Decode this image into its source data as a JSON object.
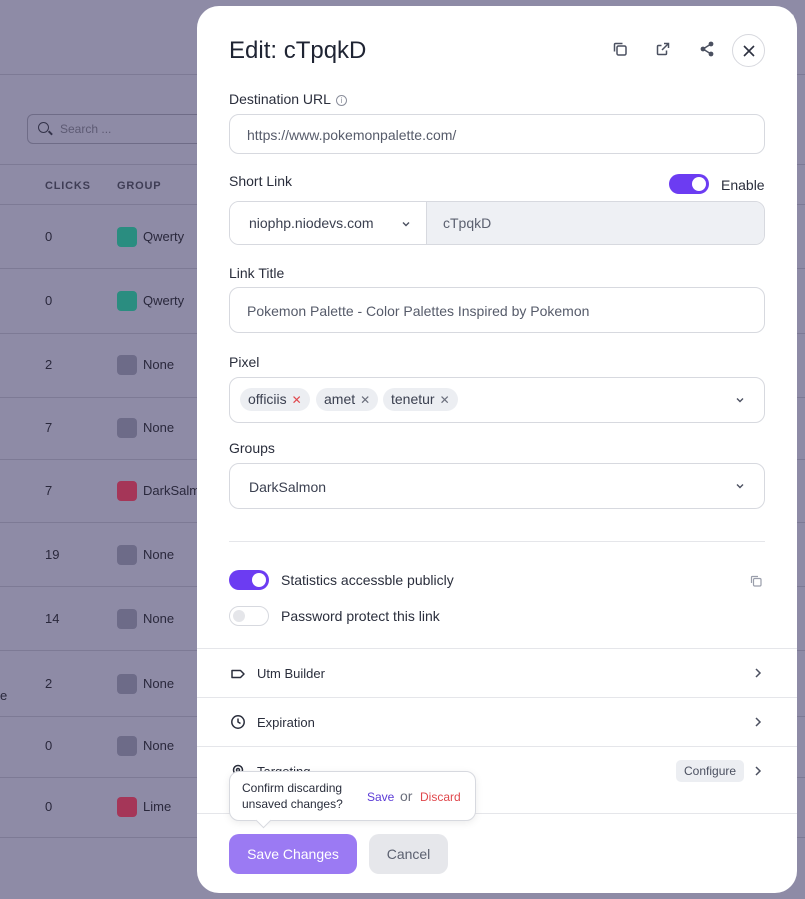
{
  "background": {
    "search_placeholder": "Search ...",
    "col_clicks": "CLICKS",
    "col_group": "GROUP",
    "rows": [
      {
        "clicks": "0",
        "group": "Qwerty",
        "color": "#2a8d80"
      },
      {
        "clicks": "0",
        "group": "Qwerty",
        "color": "#2a8d80"
      },
      {
        "clicks": "2",
        "group": "None",
        "color": "#6d6b88"
      },
      {
        "clicks": "7",
        "group": "None",
        "color": "#6d6b88"
      },
      {
        "clicks": "7",
        "group": "DarkSalm",
        "color": "#a53658"
      },
      {
        "clicks": "19",
        "group": "None",
        "color": "#6d6b88"
      },
      {
        "clicks": "14",
        "group": "None",
        "color": "#6d6b88"
      },
      {
        "clicks": "2",
        "group": "None",
        "color": "#6d6b88"
      },
      {
        "clicks": "0",
        "group": "None",
        "color": "#6d6b88"
      },
      {
        "clicks": "0",
        "group": "Lime",
        "color": "#a53658"
      }
    ],
    "edge_text": "e"
  },
  "modal": {
    "title": "Edit: cTpqkD",
    "header_icons": [
      "copy-icon",
      "external-link-icon",
      "share-icon",
      "close-icon"
    ],
    "destination": {
      "label": "Destination URL",
      "value": "https://www.pokemonpalette.com/"
    },
    "short_link": {
      "label": "Short Link",
      "enable_label": "Enable",
      "enabled": true,
      "domain": "niophp.niodevs.com",
      "slug": "cTpqkD"
    },
    "link_title": {
      "label": "Link Title",
      "value": "Pokemon Palette - Color Palettes Inspired by Pokemon"
    },
    "pixel": {
      "label": "Pixel",
      "chips": [
        "officiis",
        "amet",
        "tenetur"
      ]
    },
    "groups": {
      "label": "Groups",
      "value": "DarkSalmon"
    },
    "statistics": {
      "label": "Statistics accessble publicly",
      "enabled": true
    },
    "password": {
      "label": "Password protect this link",
      "enabled": false
    },
    "sections": [
      {
        "label": "Utm Builder",
        "icon": "tag-icon"
      },
      {
        "label": "Expiration",
        "icon": "clock-icon"
      },
      {
        "label": "Targeting",
        "icon": "target-icon",
        "badge": "Configure"
      }
    ],
    "tooltip": {
      "message": "Confirm discarding unsaved changes?",
      "save": "Save",
      "or": "or",
      "discard": "Discard"
    },
    "buttons": {
      "save_changes": "Save Changes",
      "cancel": "Cancel"
    },
    "accent_color": "#6c3cf2"
  }
}
